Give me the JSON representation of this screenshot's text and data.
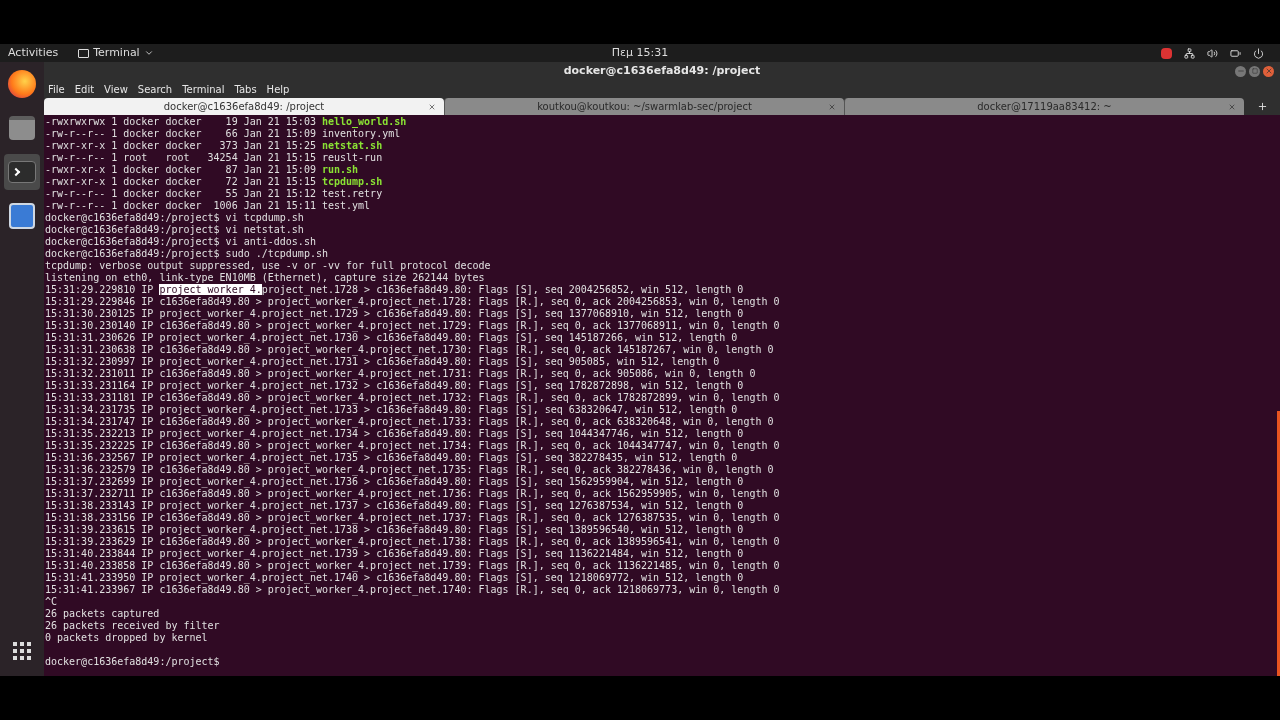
{
  "top_panel": {
    "activities": "Activities",
    "app_menu": "Terminal",
    "clock": "Πεμ 15:31"
  },
  "window": {
    "title": "docker@c1636efa8d49: /project"
  },
  "menu": [
    "File",
    "Edit",
    "View",
    "Search",
    "Terminal",
    "Tabs",
    "Help"
  ],
  "tabs": [
    {
      "label": "docker@c1636efa8d49: /project",
      "selected": true
    },
    {
      "label": "koutkou@koutkou: ~/swarmlab-sec/project",
      "selected": false
    },
    {
      "label": "docker@17119aa83412: ~",
      "selected": false
    }
  ],
  "terminal_lines": [
    [
      {
        "text": "-rwxrwxrwx 1 docker docker    19 Jan 21 15:03 ",
        "kind": "plain"
      },
      {
        "text": "hello_world.sh",
        "kind": "exec"
      }
    ],
    [
      {
        "text": "-rw-r--r-- 1 docker docker    66 Jan 21 15:09 inventory.yml",
        "kind": "plain"
      }
    ],
    [
      {
        "text": "-rwxr-xr-x 1 docker docker   373 Jan 21 15:25 ",
        "kind": "plain"
      },
      {
        "text": "netstat.sh",
        "kind": "exec"
      }
    ],
    [
      {
        "text": "-rw-r--r-- 1 root   root   34254 Jan 21 15:15 reuslt-run",
        "kind": "plain"
      }
    ],
    [
      {
        "text": "-rwxr-xr-x 1 docker docker    87 Jan 21 15:09 ",
        "kind": "plain"
      },
      {
        "text": "run.sh",
        "kind": "exec"
      }
    ],
    [
      {
        "text": "-rwxr-xr-x 1 docker docker    72 Jan 21 15:15 ",
        "kind": "plain"
      },
      {
        "text": "tcpdump.sh",
        "kind": "exec"
      }
    ],
    [
      {
        "text": "-rw-r--r-- 1 docker docker    55 Jan 21 15:12 test.retry",
        "kind": "plain"
      }
    ],
    [
      {
        "text": "-rw-r--r-- 1 docker docker  1006 Jan 21 15:11 test.yml",
        "kind": "plain"
      }
    ],
    [
      {
        "text": "docker@c1636efa8d49:/project$ vi tcpdump.sh",
        "kind": "plain"
      }
    ],
    [
      {
        "text": "docker@c1636efa8d49:/project$ vi netstat.sh",
        "kind": "plain"
      }
    ],
    [
      {
        "text": "docker@c1636efa8d49:/project$ vi anti-ddos.sh",
        "kind": "plain"
      }
    ],
    [
      {
        "text": "docker@c1636efa8d49:/project$ sudo ./tcpdump.sh",
        "kind": "plain"
      }
    ],
    [
      {
        "text": "tcpdump: verbose output suppressed, use -v or -vv for full protocol decode",
        "kind": "plain"
      }
    ],
    [
      {
        "text": "listening on eth0, link-type EN10MB (Ethernet), capture size 262144 bytes",
        "kind": "plain"
      }
    ],
    [
      {
        "text": "15:31:29.229810 IP ",
        "kind": "plain"
      },
      {
        "text": "project_worker_4.",
        "kind": "selected"
      },
      {
        "text": "project_net.1728 > c1636efa8d49.80: Flags [S], seq 2004256852, win 512, length 0",
        "kind": "plain"
      }
    ],
    [
      {
        "text": "15:31:29.229846 IP c1636efa8d49.80 > project_worker_4.project_net.1728: Flags [R.], seq 0, ack 2004256853, win 0, length 0",
        "kind": "plain"
      }
    ],
    [
      {
        "text": "15:31:30.230125 IP project_worker_4.project_net.1729 > c1636efa8d49.80: Flags [S], seq 1377068910, win 512, length 0",
        "kind": "plain"
      }
    ],
    [
      {
        "text": "15:31:30.230140 IP c1636efa8d49.80 > project_worker_4.project_net.1729: Flags [R.], seq 0, ack 1377068911, win 0, length 0",
        "kind": "plain"
      }
    ],
    [
      {
        "text": "15:31:31.230626 IP project_worker_4.project_net.1730 > c1636efa8d49.80: Flags [S], seq 145187266, win 512, length 0",
        "kind": "plain"
      }
    ],
    [
      {
        "text": "15:31:31.230638 IP c1636efa8d49.80 > project_worker_4.project_net.1730: Flags [R.], seq 0, ack 145187267, win 0, length 0",
        "kind": "plain"
      }
    ],
    [
      {
        "text": "15:31:32.230997 IP project_worker_4.project_net.1731 > c1636efa8d49.80: Flags [S], seq 905085, win 512, length 0",
        "kind": "plain"
      }
    ],
    [
      {
        "text": "15:31:32.231011 IP c1636efa8d49.80 > project_worker_4.project_net.1731: Flags [R.], seq 0, ack 905086, win 0, length 0",
        "kind": "plain"
      }
    ],
    [
      {
        "text": "15:31:33.231164 IP project_worker_4.project_net.1732 > c1636efa8d49.80: Flags [S], seq 1782872898, win 512, length 0",
        "kind": "plain"
      }
    ],
    [
      {
        "text": "15:31:33.231181 IP c1636efa8d49.80 > project_worker_4.project_net.1732: Flags [R.], seq 0, ack 1782872899, win 0, length 0",
        "kind": "plain"
      }
    ],
    [
      {
        "text": "15:31:34.231735 IP project_worker_4.project_net.1733 > c1636efa8d49.80: Flags [S], seq 638320647, win 512, length 0",
        "kind": "plain"
      }
    ],
    [
      {
        "text": "15:31:34.231747 IP c1636efa8d49.80 > project_worker_4.project_net.1733: Flags [R.], seq 0, ack 638320648, win 0, length 0",
        "kind": "plain"
      }
    ],
    [
      {
        "text": "15:31:35.232213 IP project_worker_4.project_net.1734 > c1636efa8d49.80: Flags [S], seq 1044347746, win 512, length 0",
        "kind": "plain"
      }
    ],
    [
      {
        "text": "15:31:35.232225 IP c1636efa8d49.80 > project_worker_4.project_net.1734: Flags [R.], seq 0, ack 1044347747, win 0, length 0",
        "kind": "plain"
      }
    ],
    [
      {
        "text": "15:31:36.232567 IP project_worker_4.project_net.1735 > c1636efa8d49.80: Flags [S], seq 382278435, win 512, length 0",
        "kind": "plain"
      }
    ],
    [
      {
        "text": "15:31:36.232579 IP c1636efa8d49.80 > project_worker_4.project_net.1735: Flags [R.], seq 0, ack 382278436, win 0, length 0",
        "kind": "plain"
      }
    ],
    [
      {
        "text": "15:31:37.232699 IP project_worker_4.project_net.1736 > c1636efa8d49.80: Flags [S], seq 1562959904, win 512, length 0",
        "kind": "plain"
      }
    ],
    [
      {
        "text": "15:31:37.232711 IP c1636efa8d49.80 > project_worker_4.project_net.1736: Flags [R.], seq 0, ack 1562959905, win 0, length 0",
        "kind": "plain"
      }
    ],
    [
      {
        "text": "15:31:38.233143 IP project_worker_4.project_net.1737 > c1636efa8d49.80: Flags [S], seq 1276387534, win 512, length 0",
        "kind": "plain"
      }
    ],
    [
      {
        "text": "15:31:38.233156 IP c1636efa8d49.80 > project_worker_4.project_net.1737: Flags [R.], seq 0, ack 1276387535, win 0, length 0",
        "kind": "plain"
      }
    ],
    [
      {
        "text": "15:31:39.233615 IP project_worker_4.project_net.1738 > c1636efa8d49.80: Flags [S], seq 1389596540, win 512, length 0",
        "kind": "plain"
      }
    ],
    [
      {
        "text": "15:31:39.233629 IP c1636efa8d49.80 > project_worker_4.project_net.1738: Flags [R.], seq 0, ack 1389596541, win 0, length 0",
        "kind": "plain"
      }
    ],
    [
      {
        "text": "15:31:40.233844 IP project_worker_4.project_net.1739 > c1636efa8d49.80: Flags [S], seq 1136221484, win 512, length 0",
        "kind": "plain"
      }
    ],
    [
      {
        "text": "15:31:40.233858 IP c1636efa8d49.80 > project_worker_4.project_net.1739: Flags [R.], seq 0, ack 1136221485, win 0, length 0",
        "kind": "plain"
      }
    ],
    [
      {
        "text": "15:31:41.233950 IP project_worker_4.project_net.1740 > c1636efa8d49.80: Flags [S], seq 1218069772, win 512, length 0",
        "kind": "plain"
      }
    ],
    [
      {
        "text": "15:31:41.233967 IP c1636efa8d49.80 > project_worker_4.project_net.1740: Flags [R.], seq 0, ack 1218069773, win 0, length 0",
        "kind": "plain"
      }
    ],
    [
      {
        "text": "^C",
        "kind": "plain"
      }
    ],
    [
      {
        "text": "26 packets captured",
        "kind": "plain"
      }
    ],
    [
      {
        "text": "26 packets received by filter",
        "kind": "plain"
      }
    ],
    [
      {
        "text": "0 packets dropped by kernel",
        "kind": "plain"
      }
    ]
  ],
  "prompt": "docker@c1636efa8d49:/project$"
}
